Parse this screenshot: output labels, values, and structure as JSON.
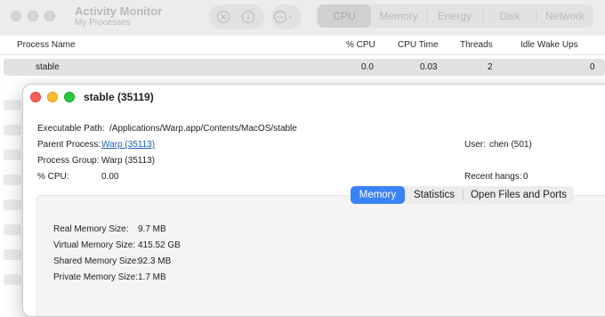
{
  "am": {
    "title": "Activity Monitor",
    "subtitle": "My Processes",
    "tabs": [
      {
        "label": "CPU",
        "selected": true
      },
      {
        "label": "Memory",
        "selected": false
      },
      {
        "label": "Energy",
        "selected": false
      },
      {
        "label": "Disk",
        "selected": false
      },
      {
        "label": "Network",
        "selected": false
      }
    ],
    "columns": [
      "Process Name",
      "% CPU",
      "CPU Time",
      "Threads",
      "Idle Wake Ups"
    ],
    "rows": [
      {
        "name": "stable",
        "cpu": "0.0",
        "cpu_time": "0.03",
        "threads": "2",
        "idle": "0"
      }
    ]
  },
  "info": {
    "title": "stable (35119)",
    "executable_label": "Executable Path:",
    "executable_value": "/Applications/Warp.app/Contents/MacOS/stable",
    "parent_label": "Parent Process:",
    "parent_value": "Warp (35113)",
    "group_label": "Process Group:",
    "group_value": "Warp (35113)",
    "cpu_label": "% CPU:",
    "cpu_value": "0.00",
    "user_label": "User:",
    "user_value": "chen (501)",
    "hangs_label": "Recent hangs:",
    "hangs_value": "0",
    "tabs": [
      {
        "label": "Memory",
        "selected": true
      },
      {
        "label": "Statistics",
        "selected": false
      },
      {
        "label": "Open Files and Ports",
        "selected": false
      }
    ],
    "memory": [
      {
        "label": "Real Memory Size:",
        "value": "9.7 MB"
      },
      {
        "label": "Virtual Memory Size:",
        "value": "415.52 GB"
      },
      {
        "label": "Shared Memory Size:",
        "value": "92.3 MB"
      },
      {
        "label": "Private Memory Size:",
        "value": "1.7 MB"
      }
    ]
  },
  "colors": {
    "accent": "#3b82f6",
    "link": "#1a5fb4",
    "close": "#fe5f57",
    "minimize": "#febc2e",
    "zoom": "#28c840"
  }
}
